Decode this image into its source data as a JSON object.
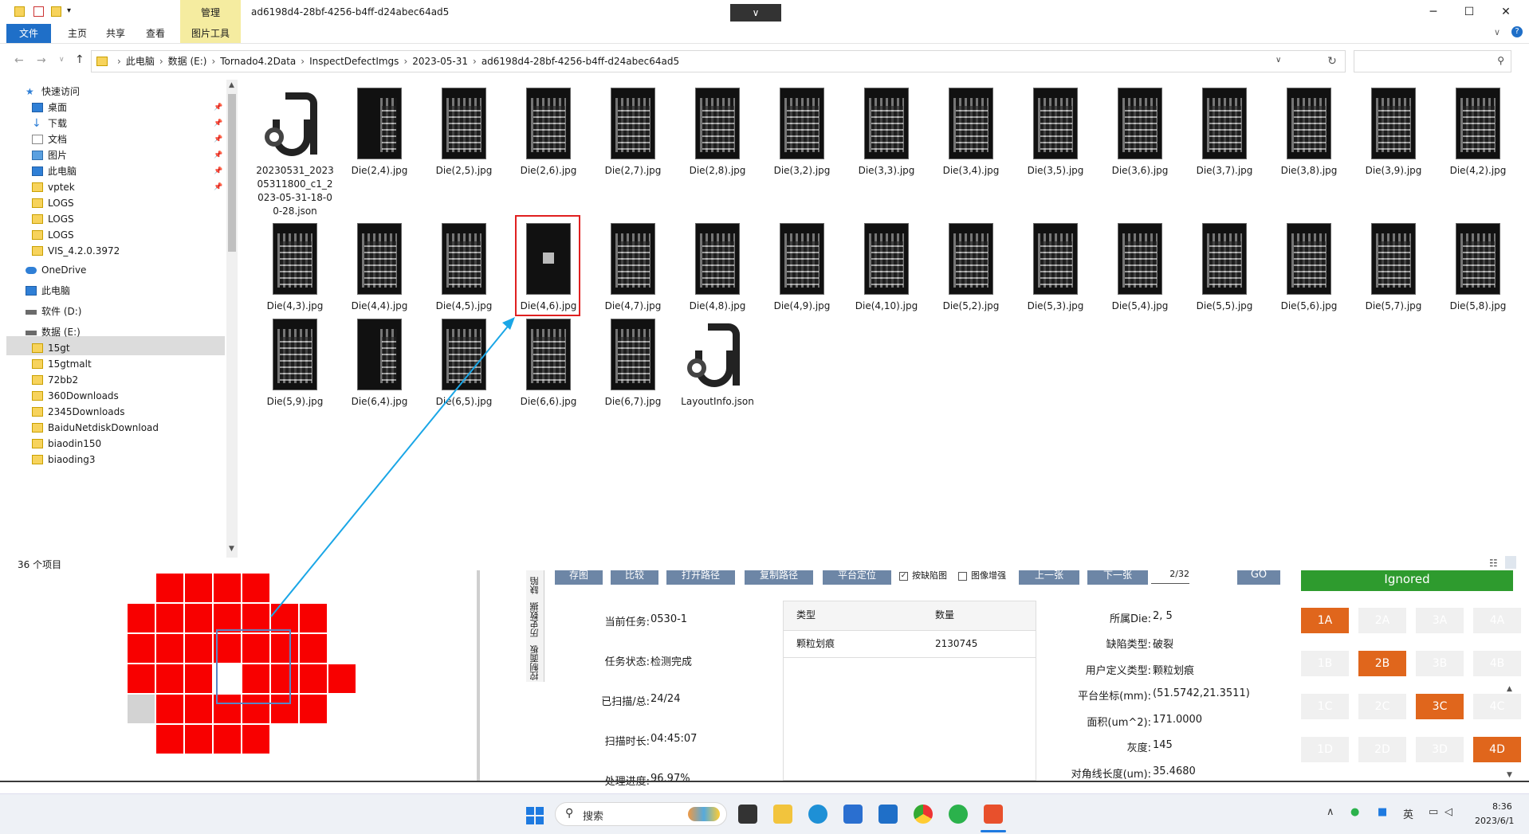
{
  "window": {
    "title": "ad6198d4-28bf-4256-b4ff-d24abec64ad5",
    "manage_tab": "管理",
    "collapse_glyph": "∨",
    "minimize": "─",
    "maximize": "☐",
    "close": "✕"
  },
  "ribbon": {
    "tabs": [
      "文件",
      "主页",
      "共享",
      "查看",
      "图片工具"
    ],
    "expand_glyph": "∨",
    "help_glyph": "?"
  },
  "address": {
    "crumbs": [
      "此电脑",
      "数据 (E:)",
      "Tornado4.2Data",
      "InspectDefectImgs",
      "2023-05-31",
      "ad6198d4-28bf-4256-b4ff-d24abec64ad5"
    ],
    "refresh_glyph": "↻",
    "search_placeholder": ""
  },
  "nav": {
    "items": [
      {
        "label": "快速访问",
        "pinned": false
      },
      {
        "label": "桌面",
        "pinned": true
      },
      {
        "label": "下载",
        "pinned": true
      },
      {
        "label": "文档",
        "pinned": true
      },
      {
        "label": "图片",
        "pinned": true
      },
      {
        "label": "此电脑",
        "pinned": true
      },
      {
        "label": "vptek",
        "pinned": true
      },
      {
        "label": "LOGS",
        "pinned": false
      },
      {
        "label": "LOGS",
        "pinned": false
      },
      {
        "label": "LOGS",
        "pinned": false
      },
      {
        "label": "VIS_4.2.0.3972",
        "pinned": false
      },
      {
        "label": "OneDrive",
        "pinned": false
      },
      {
        "label": "此电脑",
        "pinned": false
      },
      {
        "label": "软件 (D:)",
        "pinned": false
      },
      {
        "label": "数据 (E:)",
        "pinned": false
      },
      {
        "label": "15gt",
        "pinned": false
      },
      {
        "label": "15gtmalt",
        "pinned": false
      },
      {
        "label": "72bb2",
        "pinned": false
      },
      {
        "label": "360Downloads",
        "pinned": false
      },
      {
        "label": "2345Downloads",
        "pinned": false
      },
      {
        "label": "BaiduNetdiskDownload",
        "pinned": false
      },
      {
        "label": "biaodin150",
        "pinned": false
      },
      {
        "label": "biaoding3",
        "pinned": false
      }
    ],
    "status": "36 个项目"
  },
  "files": [
    {
      "name": "20230531_2023 05311800_c1_2 023-05-31-18-0 0-28.json",
      "kind": "json"
    },
    {
      "name": "Die(2,4).jpg",
      "kind": "half"
    },
    {
      "name": "Die(2,5).jpg",
      "kind": "die"
    },
    {
      "name": "Die(2,6).jpg",
      "kind": "die"
    },
    {
      "name": "Die(2,7).jpg",
      "kind": "die"
    },
    {
      "name": "Die(2,8).jpg",
      "kind": "die"
    },
    {
      "name": "Die(3,2).jpg",
      "kind": "die"
    },
    {
      "name": "Die(3,3).jpg",
      "kind": "die"
    },
    {
      "name": "Die(3,4).jpg",
      "kind": "die"
    },
    {
      "name": "Die(3,5).jpg",
      "kind": "die"
    },
    {
      "name": "Die(3,6).jpg",
      "kind": "die"
    },
    {
      "name": "Die(3,7).jpg",
      "kind": "die"
    },
    {
      "name": "Die(3,8).jpg",
      "kind": "die"
    },
    {
      "name": "Die(3,9).jpg",
      "kind": "die"
    },
    {
      "name": "Die(4,2).jpg",
      "kind": "die"
    },
    {
      "name": "Die(4,3).jpg",
      "kind": "die"
    },
    {
      "name": "Die(4,4).jpg",
      "kind": "die"
    },
    {
      "name": "Die(4,5).jpg",
      "kind": "die"
    },
    {
      "name": "Die(4,6).jpg",
      "kind": "dark"
    },
    {
      "name": "Die(4,7).jpg",
      "kind": "die"
    },
    {
      "name": "Die(4,8).jpg",
      "kind": "die"
    },
    {
      "name": "Die(4,9).jpg",
      "kind": "die"
    },
    {
      "name": "Die(4,10).jpg",
      "kind": "die"
    },
    {
      "name": "Die(5,2).jpg",
      "kind": "die"
    },
    {
      "name": "Die(5,3).jpg",
      "kind": "die"
    },
    {
      "name": "Die(5,4).jpg",
      "kind": "die"
    },
    {
      "name": "Die(5,5).jpg",
      "kind": "die"
    },
    {
      "name": "Die(5,6).jpg",
      "kind": "die"
    },
    {
      "name": "Die(5,7).jpg",
      "kind": "die"
    },
    {
      "name": "Die(5,8).jpg",
      "kind": "die"
    },
    {
      "name": "Die(5,9).jpg",
      "kind": "die"
    },
    {
      "name": "Die(6,4).jpg",
      "kind": "half"
    },
    {
      "name": "Die(6,5).jpg",
      "kind": "die"
    },
    {
      "name": "Die(6,6).jpg",
      "kind": "die"
    },
    {
      "name": "Die(6,7).jpg",
      "kind": "die"
    },
    {
      "name": "LayoutInfo.json",
      "kind": "json"
    }
  ],
  "selected_file": "Die(4,6).jpg",
  "wafer_map": {
    "colors": {
      "defect": "#f80000",
      "empty": "#d3d3d3",
      "selected": "#ffffff",
      "frame": "#5a86c6",
      "arrow": "#1aa6e6"
    }
  },
  "toolbar": {
    "buttons": [
      "存图",
      "比较",
      "打开路径",
      "复制路径",
      "平台定位",
      "上一张",
      "下一张"
    ],
    "check_follow": "按缺陷图",
    "check_follow_checked": true,
    "check_enhance": "图像增强",
    "check_enhance_checked": false,
    "page": "2/32",
    "go": "GO",
    "ignored": "Ignored"
  },
  "vertical_tabs": [
    "缺陷",
    "历史数据",
    "控制面板"
  ],
  "task_info": [
    {
      "label": "当前任务:",
      "value": "0530-1"
    },
    {
      "label": "任务状态:",
      "value": "检测完成"
    },
    {
      "label": "已扫描/总:",
      "value": "24/24"
    },
    {
      "label": "扫描时长:",
      "value": "04:45:07"
    },
    {
      "label": "处理进度:",
      "value": "96.97%"
    }
  ],
  "defect_table": {
    "headers": [
      "类型",
      "数量"
    ],
    "rows": [
      [
        "颗粒划痕",
        "2130745"
      ]
    ]
  },
  "defect_detail": [
    {
      "label": "所属Die:",
      "value": "2, 5"
    },
    {
      "label": "缺陷类型:",
      "value": "破裂"
    },
    {
      "label": "用户定义类型:",
      "value": "颗粒划痕"
    },
    {
      "label": "平台坐标(mm):",
      "value": "(51.5742,21.3511)"
    },
    {
      "label": "面积(um^2):",
      "value": "171.0000"
    },
    {
      "label": "灰度:",
      "value": "145"
    },
    {
      "label": "对角线长度(um):",
      "value": "35.4680"
    }
  ],
  "region_grid": [
    [
      {
        "label": "1A",
        "on": true
      },
      {
        "label": "2A",
        "on": false
      },
      {
        "label": "3A",
        "on": false
      },
      {
        "label": "4A",
        "on": false
      }
    ],
    [
      {
        "label": "1B",
        "on": false
      },
      {
        "label": "2B",
        "on": true
      },
      {
        "label": "3B",
        "on": false
      },
      {
        "label": "4B",
        "on": false
      }
    ],
    [
      {
        "label": "1C",
        "on": false
      },
      {
        "label": "2C",
        "on": false
      },
      {
        "label": "3C",
        "on": true
      },
      {
        "label": "4C",
        "on": false
      }
    ],
    [
      {
        "label": "1D",
        "on": false
      },
      {
        "label": "2D",
        "on": false
      },
      {
        "label": "3D",
        "on": false
      },
      {
        "label": "4D",
        "on": true
      }
    ]
  ],
  "taskbar": {
    "search_label": "搜索",
    "ime": "英",
    "time": "8:36",
    "date": "2023/6/1"
  }
}
